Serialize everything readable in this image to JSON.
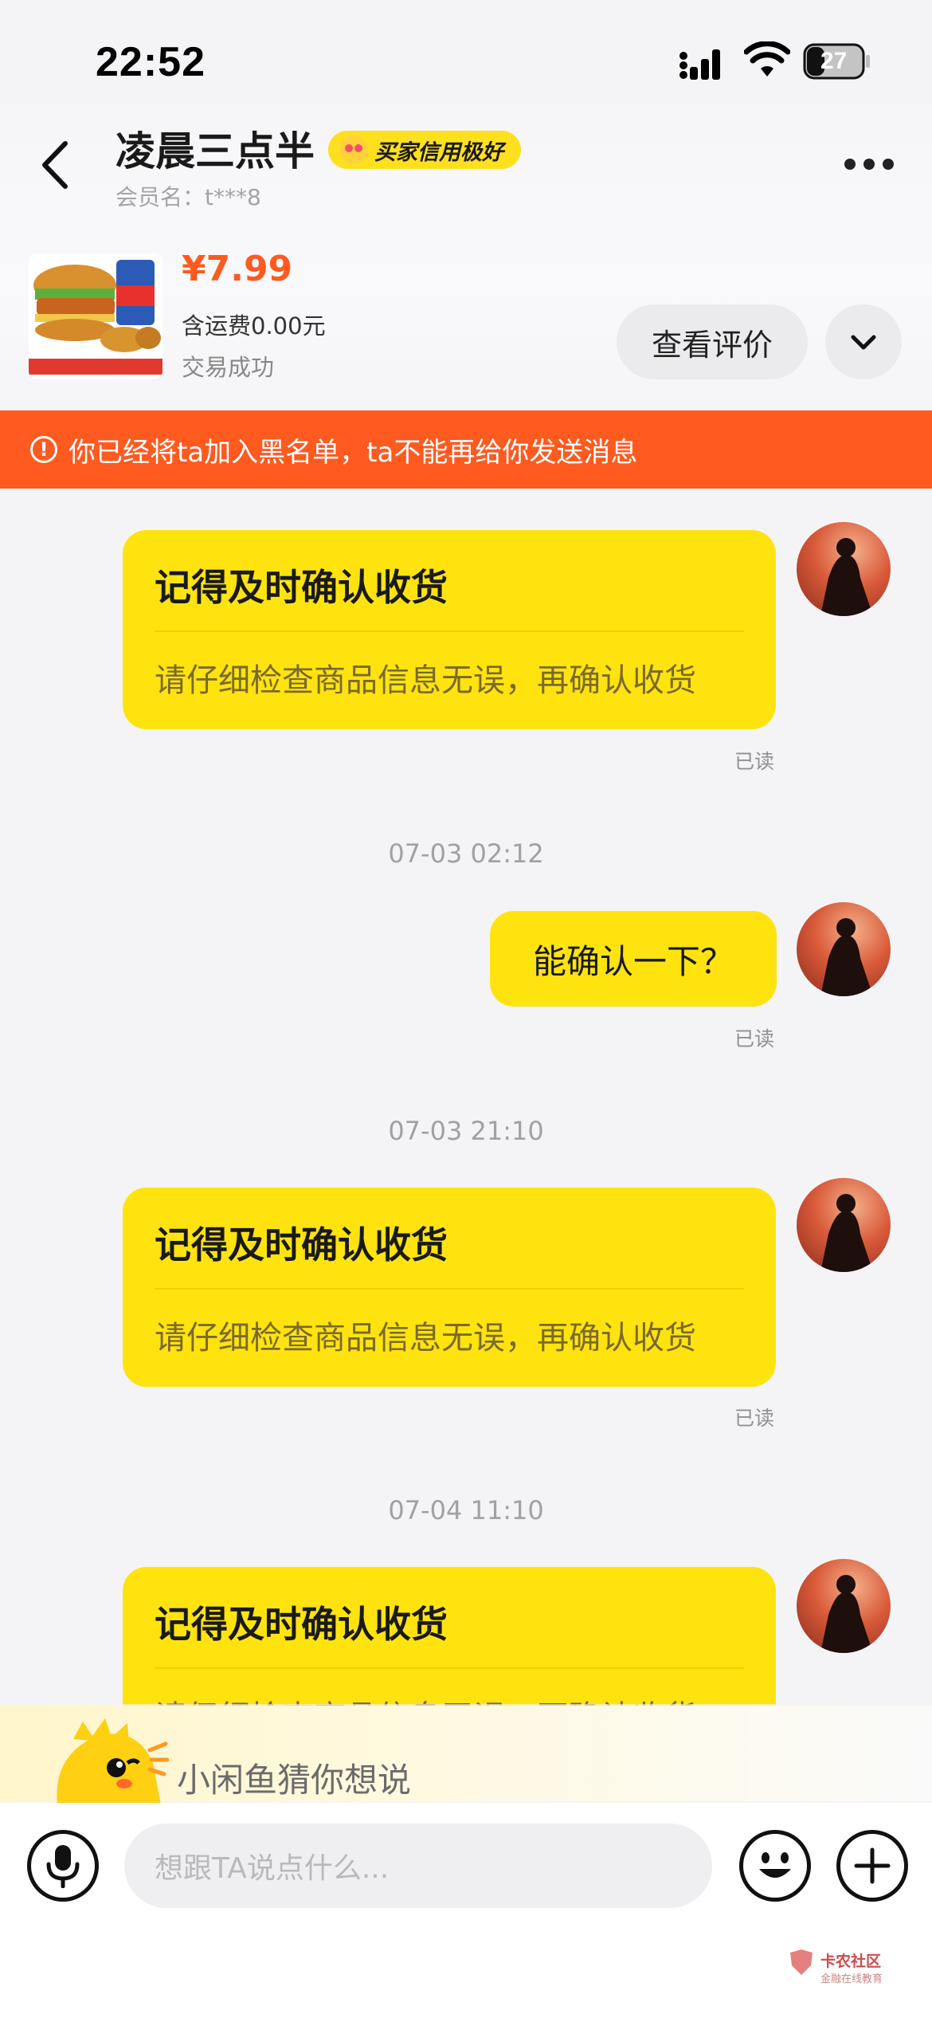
{
  "status_bar": {
    "time": "22:52",
    "battery": "27"
  },
  "header": {
    "title": "凌晨三点半",
    "credit_badge": "买家信用极好",
    "member": "会员名：t***8"
  },
  "product": {
    "price": "¥7.99",
    "shipping": "含运费0.00元",
    "status": "交易成功",
    "review_button": "查看评价"
  },
  "banner": {
    "text": "你已经将ta加入黑名单，ta不能再给你发送消息"
  },
  "messages": [
    {
      "type": "card",
      "title": "记得及时确认收货",
      "body": "请仔细检查商品信息无误，再确认收货",
      "read": "已读"
    },
    {
      "type": "time",
      "text": "07-03 02:12"
    },
    {
      "type": "text",
      "text": "能确认一下？",
      "read": "已读"
    },
    {
      "type": "time",
      "text": "07-03 21:10"
    },
    {
      "type": "card",
      "title": "记得及时确认收货",
      "body": "请仔细检查商品信息无误，再确认收货",
      "read": "已读"
    },
    {
      "type": "time",
      "text": "07-04 11:10"
    },
    {
      "type": "card",
      "title": "记得及时确认收货",
      "body": "请仔细检查商品信息无误，再确认收货"
    }
  ],
  "suggestion": {
    "text": "小闲鱼猜你想说"
  },
  "input": {
    "placeholder": "想跟TA说点什么..."
  },
  "watermark": {
    "text": "卡农社区",
    "sub": "金融在线教育"
  },
  "colors": {
    "accent": "#ffe30f",
    "banner": "#ff5a1f",
    "price": "#ff5a1f"
  }
}
